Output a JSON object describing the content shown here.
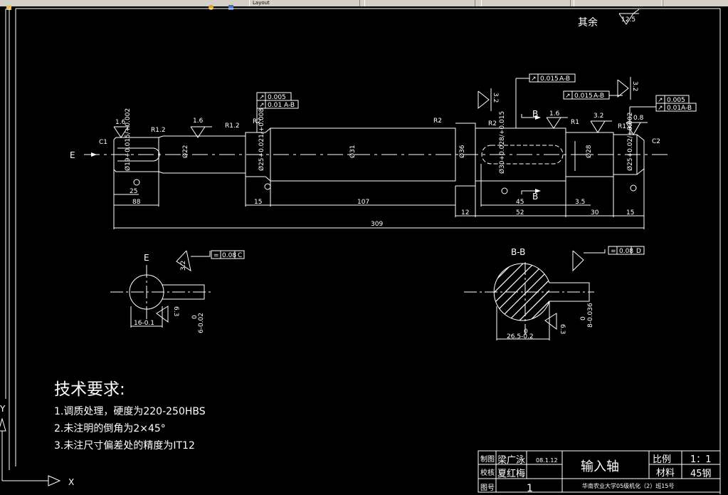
{
  "toolbar": {
    "tabs": [
      "Layout",
      "",
      "",
      "",
      ""
    ]
  },
  "roughness": {
    "other_label": "其余",
    "other_value": "12.5",
    "marks": [
      "1.6",
      "1.6",
      "1.6",
      "3.2",
      "0.8",
      "3.2",
      "3.2",
      "3.2",
      "6.3",
      "6.3"
    ]
  },
  "views": {
    "main": {
      "section_arrow": "E",
      "section_bb": "B",
      "chamfer_left": "C1",
      "chamfer_right": "C2",
      "radii": [
        "R1.2",
        "R1.2",
        "R2",
        "R2",
        "R2",
        "R1",
        "R1.2"
      ],
      "diameters": [
        "Ø19+0.015/+0.002",
        "Ø22",
        "Ø25+0.021/+0.008",
        "Ø31",
        "Ø36",
        "Ø30+0.028/+0.015",
        "Ø28",
        "Ø25+0.02/+0.002"
      ],
      "lengths": [
        "25",
        "88",
        "15",
        "107",
        "309",
        "12",
        "52",
        "45",
        "3.5",
        "30",
        "15"
      ],
      "tolerance_frames": [
        {
          "symbol": "↗",
          "value": "0.005",
          "datum": ""
        },
        {
          "symbol": "↗",
          "value": "0.01",
          "datum": "A-B"
        },
        {
          "symbol": "↗",
          "value": "0.015",
          "datum": "A-B"
        },
        {
          "symbol": "↗",
          "value": "0.015",
          "datum": "A-B"
        },
        {
          "symbol": "↗",
          "value": "0.005",
          "datum": ""
        },
        {
          "symbol": "↗",
          "value": "0.01",
          "datum": "A-B"
        }
      ]
    },
    "section_e": {
      "title": "E",
      "width": "16-0.1",
      "keyway": "6-0.02",
      "keyway_upper": "0",
      "frame": {
        "symbol": "=",
        "value": "0.08",
        "datum": "C"
      }
    },
    "section_bb": {
      "title": "B-B",
      "width": "26.5-0.2",
      "width_upper": "0",
      "keyway": "8-0.036",
      "keyway_upper": "0",
      "frame": {
        "symbol": "=",
        "value": "0.08",
        "datum": "D"
      }
    }
  },
  "notes": {
    "title": "技术要求:",
    "items": [
      "1.调质处理，硬度为220-250HBS",
      "2.未注明的倒角为2×45°",
      "3.未注尺寸偏差处的精度为IT12"
    ]
  },
  "title_block": {
    "drawn_label": "制图",
    "drawn_name": "梁广泳",
    "date": "08.1.12",
    "check_label": "校核",
    "check_name": "夏红梅",
    "drawing_no_label": "图号",
    "drawing_no": "1",
    "part_name": "输入轴",
    "scale_label": "比例",
    "scale_value": "1：1",
    "material_label": "材料",
    "material_value": "45钢",
    "school": "华南农业大学05级机化（2）班15号"
  },
  "ucs": {
    "x_label": "X",
    "y_label": "Y"
  },
  "colors": {
    "background": "#000000",
    "lines": "#ffffff",
    "toolbar": "#d4d0c8"
  }
}
